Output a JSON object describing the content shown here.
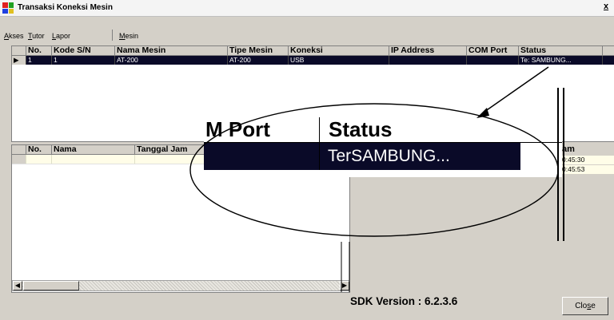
{
  "window": {
    "title": "Transaksi Koneksi Mesin",
    "close_glyph": "x"
  },
  "menu": [
    {
      "label": "Akses",
      "accel": "A",
      "rest": "kses"
    },
    {
      "label": "Tutor",
      "accel": "T",
      "rest": "utor"
    },
    {
      "label": "Lapor",
      "accel": "L",
      "rest": "apor"
    },
    {
      "label": "Mesin",
      "accel": "M",
      "rest": "esin"
    }
  ],
  "machines": {
    "columns": [
      "No.",
      "Kode S/N",
      "Nama Mesin",
      "Tipe Mesin",
      "Koneksi",
      "IP Address",
      "COM Port",
      "Status"
    ],
    "rows": [
      {
        "no": "1",
        "kode": "1",
        "nama": "AT-200",
        "tipe": "AT-200",
        "koneksi": "USB",
        "ip": "",
        "com": "",
        "status": "Te: SAMBUNG..."
      }
    ]
  },
  "transactions": {
    "columns": [
      "No.",
      "Nama",
      "Tanggal Jam"
    ],
    "right_column": "am",
    "right_values": [
      "0:45:30",
      "0:45:53"
    ]
  },
  "zoom": {
    "col_left": "M Port",
    "col_right": "Status",
    "value": "TerSAMBUNG..."
  },
  "footer": {
    "sdk": "SDK Version : 6.2.3.6",
    "close_label": "Close",
    "close_accel": "s"
  },
  "colors": {
    "selected_row": "#0a0a28",
    "window_bg": "#d4d0c8",
    "yellow_row": "#fffde8"
  }
}
